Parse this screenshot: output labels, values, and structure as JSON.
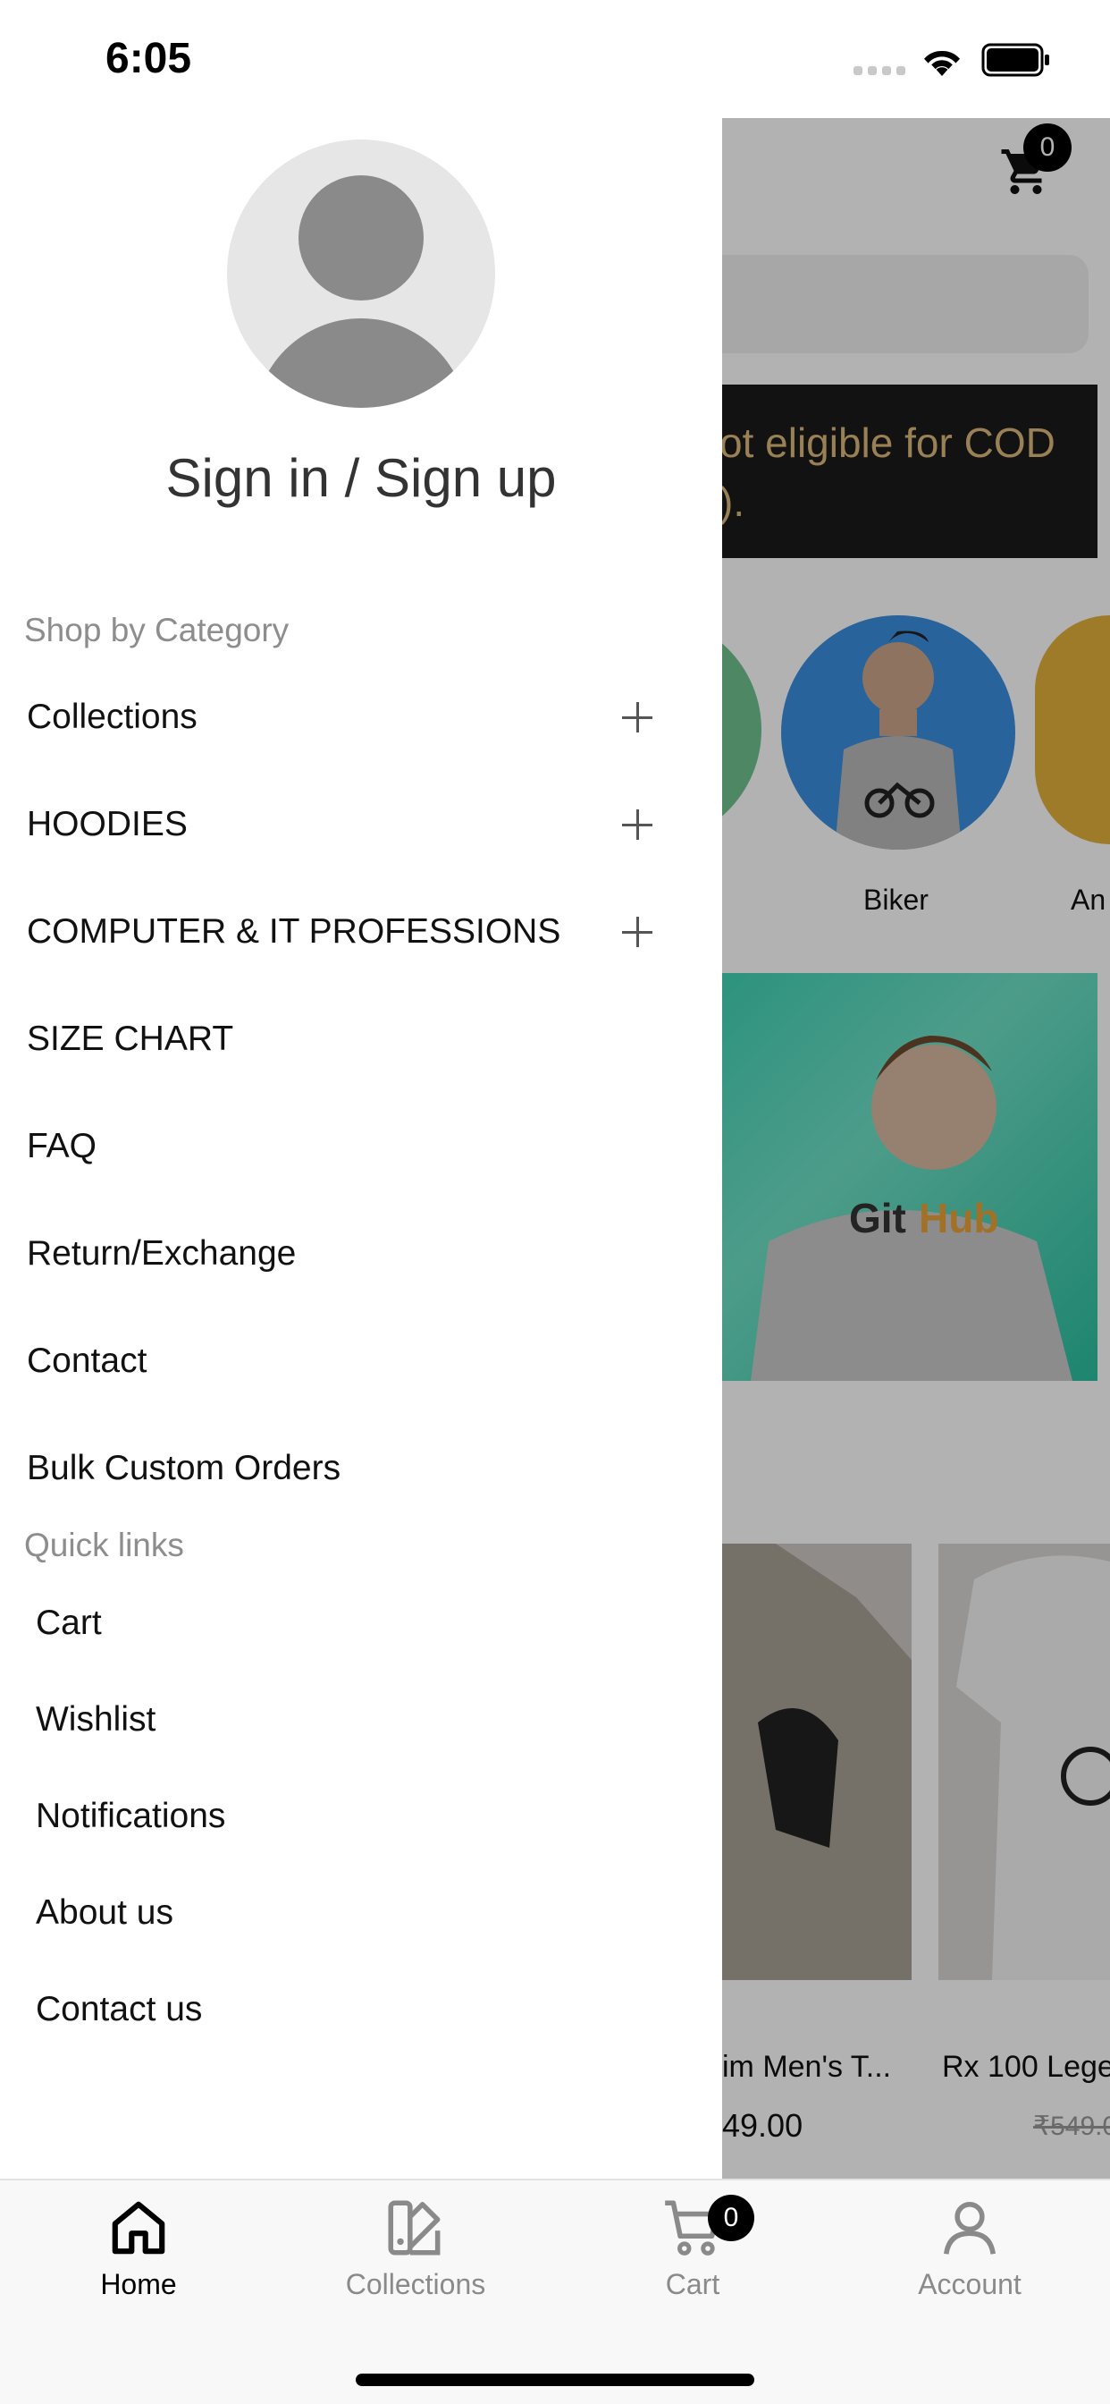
{
  "status_bar": {
    "time": "6:05"
  },
  "background": {
    "cart_count": "0",
    "cod_banner": {
      "line1": "ot eligible for COD",
      "line2": ")."
    },
    "categories": [
      {
        "label": "Biker"
      },
      {
        "label": "An"
      }
    ],
    "products": [
      {
        "title": "im Men's T...",
        "price": "49.00"
      },
      {
        "title": "Rx 100 Lege",
        "old_price": "₹549.0"
      }
    ]
  },
  "drawer": {
    "sign_in_label": "Sign in / Sign up",
    "shop_by_category_title": "Shop by Category",
    "categories": [
      {
        "label": "Collections",
        "expandable": true
      },
      {
        "label": "HOODIES",
        "expandable": true
      },
      {
        "label": "COMPUTER & IT PROFESSIONS",
        "expandable": true
      },
      {
        "label": "SIZE CHART",
        "expandable": false
      },
      {
        "label": "FAQ",
        "expandable": false
      },
      {
        "label": "Return/Exchange",
        "expandable": false
      },
      {
        "label": "Contact",
        "expandable": false
      },
      {
        "label": "Bulk Custom Orders",
        "expandable": false
      }
    ],
    "quick_links_title": "Quick links",
    "quick_links": [
      {
        "label": "Cart"
      },
      {
        "label": "Wishlist"
      },
      {
        "label": "Notifications"
      },
      {
        "label": "About us"
      },
      {
        "label": "Contact us"
      }
    ]
  },
  "tab_bar": {
    "tabs": [
      {
        "label": "Home",
        "icon": "home-icon",
        "active": true
      },
      {
        "label": "Collections",
        "icon": "collections-icon",
        "active": false
      },
      {
        "label": "Cart",
        "icon": "cart-icon",
        "active": false,
        "badge": "0"
      },
      {
        "label": "Account",
        "icon": "account-icon",
        "active": false
      }
    ]
  }
}
